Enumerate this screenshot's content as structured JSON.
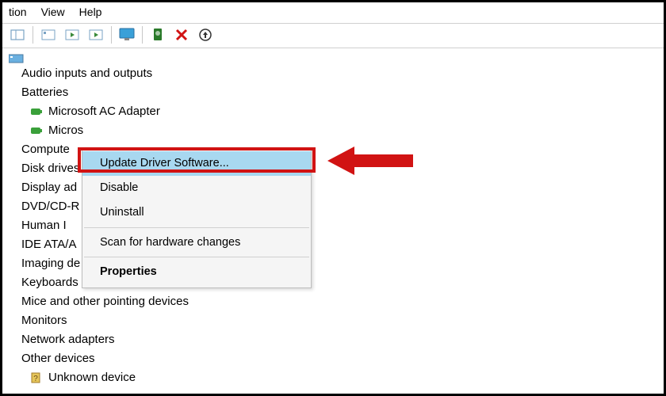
{
  "menubar": {
    "items": [
      "tion",
      "View",
      "Help"
    ]
  },
  "tree": {
    "categories": [
      {
        "label": "Audio inputs and outputs"
      },
      {
        "label": "Batteries",
        "children": [
          {
            "label": "Microsoft AC Adapter"
          },
          {
            "label": "Micros"
          }
        ]
      },
      {
        "label": "Compute"
      },
      {
        "label": "Disk drives"
      },
      {
        "label": "Display ad"
      },
      {
        "label": "DVD/CD-R"
      },
      {
        "label": "Human I"
      },
      {
        "label": "IDE ATA/A"
      },
      {
        "label": "Imaging de"
      },
      {
        "label": "Keyboards"
      },
      {
        "label": "Mice and other pointing devices"
      },
      {
        "label": "Monitors"
      },
      {
        "label": "Network adapters"
      },
      {
        "label": "Other devices",
        "children": [
          {
            "label": "Unknown device"
          }
        ]
      }
    ]
  },
  "context_menu": {
    "items": [
      {
        "label": "Update Driver Software...",
        "highlighted": true
      },
      {
        "label": "Disable"
      },
      {
        "label": "Uninstall"
      },
      {
        "sep": true
      },
      {
        "label": "Scan for hardware changes"
      },
      {
        "sep": true
      },
      {
        "label": "Properties",
        "bold": true
      }
    ]
  }
}
